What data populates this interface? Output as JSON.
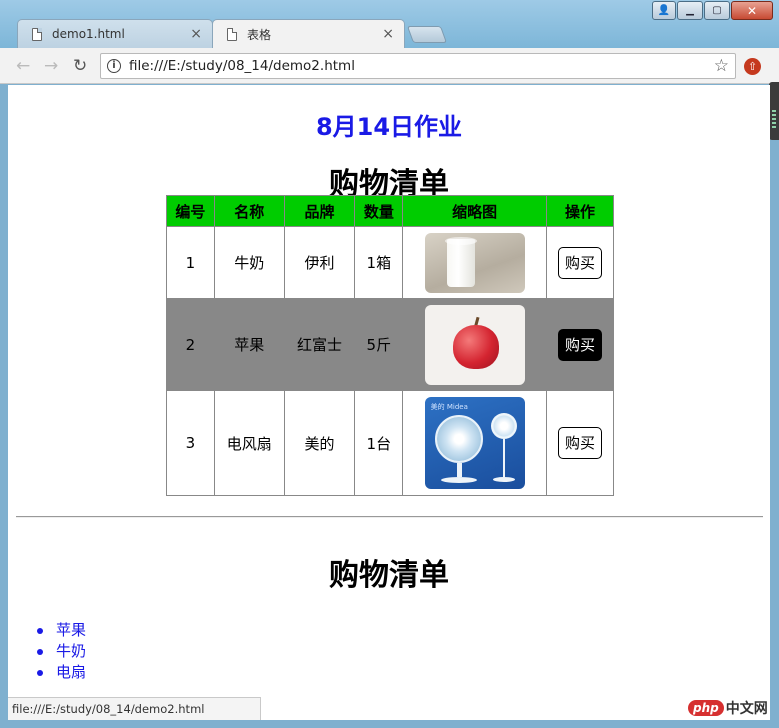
{
  "browser": {
    "tabs": [
      {
        "title": "demo1.html",
        "close": "×"
      },
      {
        "title": "表格",
        "close": "×"
      }
    ],
    "url": "file:///E:/study/08_14/demo2.html",
    "status_url": "file:///E:/study/08_14/demo2.html",
    "window_buttons": {
      "minimize": "▁",
      "maximize": "▢",
      "close": "✕",
      "user": "👤"
    },
    "nav": {
      "back": "←",
      "forward": "→",
      "reload": "↻",
      "info": "i",
      "star": "☆"
    }
  },
  "page": {
    "heading": "8月14日作业",
    "table_caption": "购物清单",
    "table": {
      "headers": [
        "编号",
        "名称",
        "品牌",
        "数量",
        "缩略图",
        "操作"
      ],
      "rows": [
        {
          "id": "1",
          "name": "牛奶",
          "brand": "伊利",
          "qty": "1箱",
          "thumb": "milk-image",
          "action": "购买"
        },
        {
          "id": "2",
          "name": "苹果",
          "brand": "红富士",
          "qty": "5斤",
          "thumb": "apple-image",
          "action": "购买"
        },
        {
          "id": "3",
          "name": "电风扇",
          "brand": "美的",
          "qty": "1台",
          "thumb": "fan-image",
          "action": "购买"
        }
      ]
    },
    "list_caption": "购物清单",
    "list_items": [
      "苹果",
      "牛奶",
      "电扇"
    ]
  },
  "fan_brand": "美的 Midea",
  "watermark": {
    "logo": "php",
    "text": "中文网"
  },
  "colors": {
    "header_bg": "#00cc00",
    "highlight_row": "#888888",
    "heading_blue": "#1a1ae6"
  }
}
